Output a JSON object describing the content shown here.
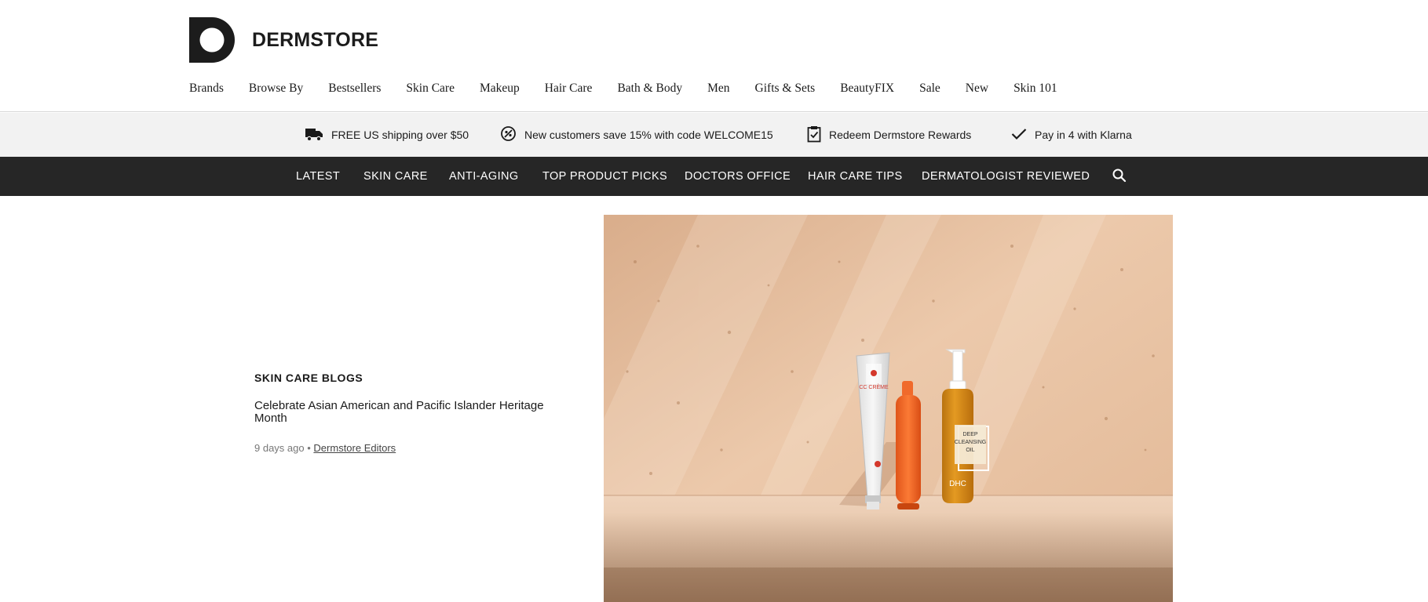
{
  "brand": {
    "name": "DERMSTORE"
  },
  "main_nav": [
    {
      "label": "Brands"
    },
    {
      "label": "Browse By"
    },
    {
      "label": "Bestsellers"
    },
    {
      "label": "Skin Care"
    },
    {
      "label": "Makeup"
    },
    {
      "label": "Hair Care"
    },
    {
      "label": "Bath & Body"
    },
    {
      "label": "Men"
    },
    {
      "label": "Gifts & Sets"
    },
    {
      "label": "BeautyFIX"
    },
    {
      "label": "Sale"
    },
    {
      "label": "New"
    },
    {
      "label": "Skin 101"
    }
  ],
  "promo_bar": [
    {
      "icon": "truck-icon",
      "text": "FREE US shipping over $50"
    },
    {
      "icon": "coupon-icon",
      "text": "New customers save 15% with code WELCOME15"
    },
    {
      "icon": "clipboard-icon",
      "text": "Redeem Dermstore Rewards"
    },
    {
      "icon": "check-icon",
      "text": "Pay in 4 with Klarna"
    }
  ],
  "blog_nav": [
    {
      "label": "LATEST"
    },
    {
      "label": "SKIN CARE"
    },
    {
      "label": "ANTI-AGING"
    },
    {
      "label": "TOP PRODUCT PICKS"
    },
    {
      "label": "DOCTORS OFFICE"
    },
    {
      "label": "HAIR CARE TIPS"
    },
    {
      "label": "DERMATOLOGIST REVIEWED"
    }
  ],
  "featured_article": {
    "category": "SKIN CARE BLOGS",
    "title": "Celebrate Asian American and Pacific Islander Heritage Month",
    "time_ago": "9 days ago",
    "separator": "•",
    "author": "Dermstore Editors"
  },
  "hero_image": {
    "product_labels": [
      "CC CRÈME",
      "DEEP CLEANSING OIL",
      "DHC"
    ]
  },
  "colors": {
    "promo_bg": "#f2f2f2",
    "blog_nav_bg": "#262626",
    "hero_bg": "#e4bf9f",
    "text": "#1a1a1a"
  }
}
